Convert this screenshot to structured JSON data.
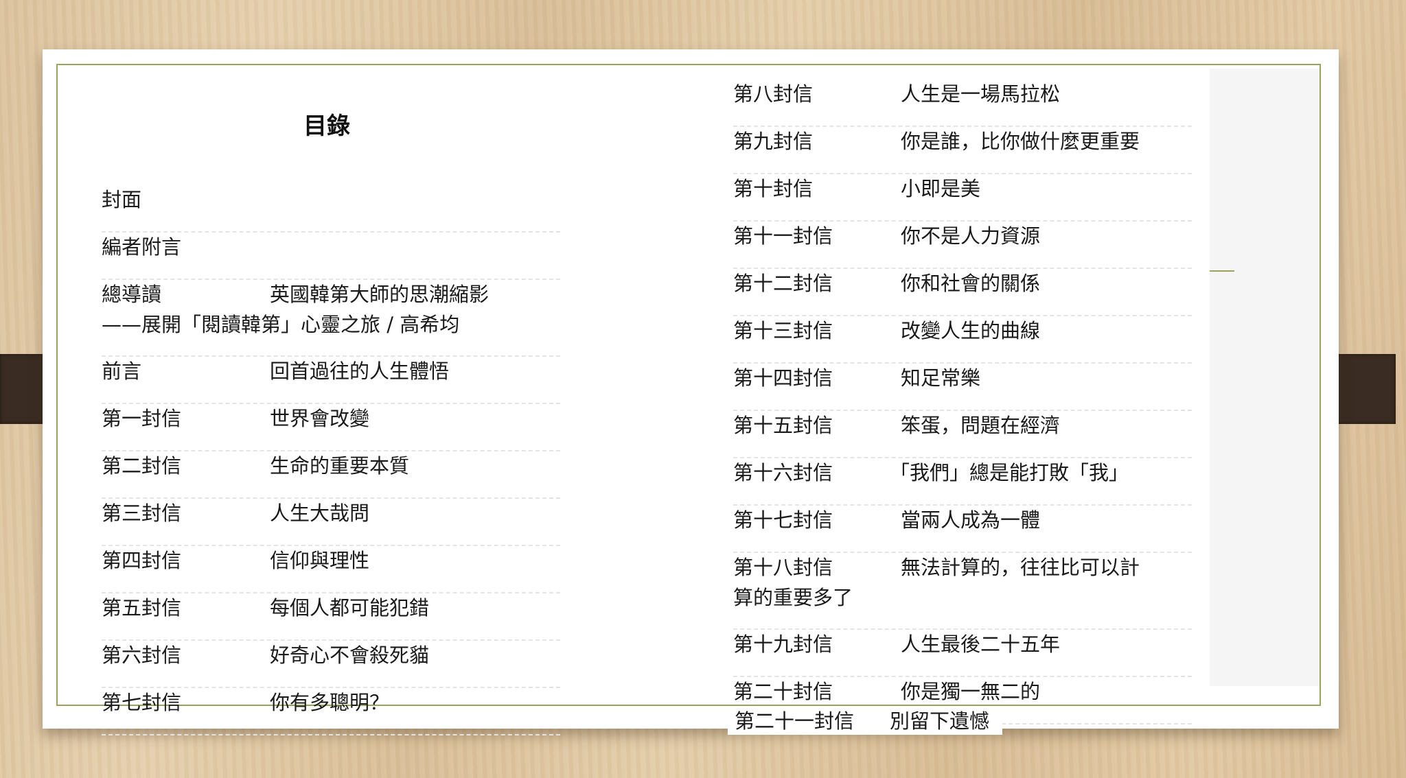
{
  "title": "目錄",
  "left_entries": [
    {
      "chapter": "封面",
      "title": ""
    },
    {
      "chapter": "編者附言",
      "title": ""
    },
    {
      "chapter": "總導讀",
      "title": "英國韓第大師的思潮縮影",
      "line2": "——展開「閱讀韓第」心靈之旅 / 高希均"
    },
    {
      "chapter": "前言",
      "title": "回首過往的人生體悟"
    },
    {
      "chapter": "第一封信",
      "title": "世界會改變"
    },
    {
      "chapter": "第二封信",
      "title": "生命的重要本質"
    },
    {
      "chapter": "第三封信",
      "title": "人生大哉問"
    },
    {
      "chapter": "第四封信",
      "title": "信仰與理性"
    },
    {
      "chapter": "第五封信",
      "title": "每個人都可能犯錯"
    },
    {
      "chapter": "第六封信",
      "title": "好奇心不會殺死貓"
    },
    {
      "chapter": "第七封信",
      "title": "你有多聰明？"
    }
  ],
  "right_entries": [
    {
      "chapter": "第八封信",
      "title": "人生是一場馬拉松"
    },
    {
      "chapter": "第九封信",
      "title": "你是誰，比你做什麼更重要"
    },
    {
      "chapter": "第十封信",
      "title": "小即是美"
    },
    {
      "chapter": "第十一封信",
      "title": "你不是人力資源"
    },
    {
      "chapter": "第十二封信",
      "title": "你和社會的關係"
    },
    {
      "chapter": "第十三封信",
      "title": "改變人生的曲線"
    },
    {
      "chapter": "第十四封信",
      "title": "知足常樂"
    },
    {
      "chapter": "第十五封信",
      "title": "笨蛋，問題在經濟"
    },
    {
      "chapter": "第十六封信",
      "title": "「我們」總是能打敗「我」"
    },
    {
      "chapter": "第十七封信",
      "title": "當兩人成為一體"
    },
    {
      "chapter": "第十八封信",
      "title": "無法計算的，往往比可以計",
      "line2": "算的重要多了"
    },
    {
      "chapter": "第十九封信",
      "title": "人生最後二十五年"
    },
    {
      "chapter": "第二十封信",
      "title": "你是獨一無二的"
    }
  ],
  "overflow_entry": {
    "chapter": "第二十一封信",
    "title": "別留下遺憾"
  }
}
